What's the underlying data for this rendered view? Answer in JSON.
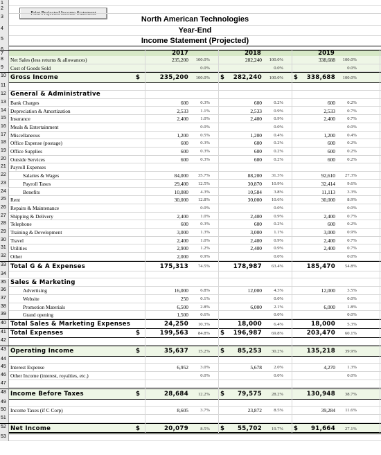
{
  "toolbar": {
    "print_label": "Print Projected Income Statement"
  },
  "header": {
    "company": "North American Technologies",
    "period": "Year-End",
    "statement": "Income Statement (Projected)"
  },
  "row_numbers": [
    "1",
    "2",
    "3",
    "4",
    "5",
    "6",
    "7",
    "8",
    "9",
    "10",
    "11",
    "12",
    "13",
    "14",
    "15",
    "16",
    "17",
    "18",
    "19",
    "20",
    "21",
    "22",
    "23",
    "24",
    "25",
    "26",
    "27",
    "28",
    "29",
    "30",
    "31",
    "32",
    "33",
    "34",
    "35",
    "36",
    "37",
    "38",
    "39",
    "40",
    "41",
    "42",
    "43",
    "44",
    "45",
    "46",
    "47",
    "48",
    "49",
    "50",
    "51",
    "52",
    "53"
  ],
  "years": [
    "2017",
    "2018",
    "2019"
  ],
  "currency": "$",
  "rows": {
    "net_sales": {
      "label": "Net Sales (less returns & allowances)",
      "v": [
        "235,200",
        "282,240",
        "338,688"
      ],
      "p": [
        "100.0%",
        "100.0%",
        "100.0%"
      ]
    },
    "cogs": {
      "label": "Cost of Goods Sold",
      "v": [
        "",
        "",
        ""
      ],
      "p": [
        "0.0%",
        "0.0%",
        "0.0%"
      ]
    },
    "gross_income": {
      "label": "Gross Income",
      "v": [
        "235,200",
        "282,240",
        "338,688"
      ],
      "p": [
        "100.0%",
        "100.0%",
        "100.0%"
      ]
    },
    "ga_header": "General & Administrative",
    "ga": [
      {
        "label": "Bank Charges",
        "v": [
          "600",
          "600",
          "600"
        ],
        "p": [
          "0.3%",
          "0.2%",
          "0.2%"
        ]
      },
      {
        "label": "Depreciation & Amortization",
        "v": [
          "2,533",
          "2,533",
          "2,533"
        ],
        "p": [
          "1.1%",
          "0.9%",
          "0.7%"
        ]
      },
      {
        "label": "Insurance",
        "v": [
          "2,400",
          "2,400",
          "2,400"
        ],
        "p": [
          "1.0%",
          "0.9%",
          "0.7%"
        ]
      },
      {
        "label": "Meals & Entertainment",
        "v": [
          "",
          "",
          ""
        ],
        "p": [
          "0.0%",
          "0.0%",
          "0.0%"
        ]
      },
      {
        "label": "Miscellaneous",
        "v": [
          "1,200",
          "1,200",
          "1,200"
        ],
        "p": [
          "0.5%",
          "0.4%",
          "0.4%"
        ]
      },
      {
        "label": "Office Expense (postage)",
        "v": [
          "600",
          "600",
          "600"
        ],
        "p": [
          "0.3%",
          "0.2%",
          "0.2%"
        ]
      },
      {
        "label": "Office Supplies",
        "v": [
          "600",
          "600",
          "600"
        ],
        "p": [
          "0.3%",
          "0.2%",
          "0.2%"
        ]
      },
      {
        "label": "Outside Services",
        "v": [
          "600",
          "600",
          "600"
        ],
        "p": [
          "0.3%",
          "0.2%",
          "0.2%"
        ]
      },
      {
        "label": "Payroll Expenses",
        "v": [
          "",
          "",
          ""
        ],
        "p": [
          "",
          "",
          ""
        ]
      },
      {
        "label": "Salaries & Wages",
        "indent": true,
        "v": [
          "84,000",
          "88,200",
          "92,610"
        ],
        "p": [
          "35.7%",
          "31.3%",
          "27.3%"
        ]
      },
      {
        "label": "Payroll Taxes",
        "indent": true,
        "v": [
          "29,400",
          "30,870",
          "32,414"
        ],
        "p": [
          "12.5%",
          "10.9%",
          "9.6%"
        ]
      },
      {
        "label": "Benefits",
        "indent": true,
        "v": [
          "10,080",
          "10,584",
          "11,113"
        ],
        "p": [
          "4.3%",
          "3.8%",
          "3.3%"
        ]
      },
      {
        "label": "Rent",
        "v": [
          "30,000",
          "30,000",
          "30,000"
        ],
        "p": [
          "12.8%",
          "10.6%",
          "8.9%"
        ]
      },
      {
        "label": "Repairs & Maintenance",
        "v": [
          "",
          "",
          ""
        ],
        "p": [
          "0.0%",
          "0.0%",
          "0.0%"
        ]
      },
      {
        "label": "Shipping & Delivery",
        "v": [
          "2,400",
          "2,400",
          "2,400"
        ],
        "p": [
          "1.0%",
          "0.9%",
          "0.7%"
        ]
      },
      {
        "label": "Telephone",
        "v": [
          "600",
          "600",
          "600"
        ],
        "p": [
          "0.3%",
          "0.2%",
          "0.2%"
        ]
      },
      {
        "label": "Training & Development",
        "v": [
          "3,000",
          "3,000",
          "3,000"
        ],
        "p": [
          "1.3%",
          "1.1%",
          "0.9%"
        ]
      },
      {
        "label": "Travel",
        "v": [
          "2,400",
          "2,400",
          "2,400"
        ],
        "p": [
          "1.0%",
          "0.9%",
          "0.7%"
        ]
      },
      {
        "label": "Utilities",
        "v": [
          "2,900",
          "2,400",
          "2,400"
        ],
        "p": [
          "1.2%",
          "0.9%",
          "0.7%"
        ]
      },
      {
        "label": "Other",
        "v": [
          "2,000",
          "",
          ""
        ],
        "p": [
          "0.9%",
          "0.0%",
          "0.0%"
        ]
      }
    ],
    "ga_total": {
      "label": "Total G & A Expenses",
      "v": [
        "175,313",
        "178,987",
        "185,470"
      ],
      "p": [
        "74.5%",
        "63.4%",
        "54.8%"
      ]
    },
    "sm_header": "Sales & Marketing",
    "sm": [
      {
        "label": "Advertising",
        "v": [
          "16,000",
          "12,000",
          "12,000"
        ],
        "p": [
          "6.8%",
          "4.3%",
          "3.5%"
        ]
      },
      {
        "label": "Website",
        "v": [
          "250",
          "",
          ""
        ],
        "p": [
          "0.1%",
          "0.0%",
          "0.0%"
        ]
      },
      {
        "label": "Promotion Materials",
        "v": [
          "6,500",
          "6,000",
          "6,000"
        ],
        "p": [
          "2.8%",
          "2.1%",
          "1.8%"
        ]
      },
      {
        "label": "Grand opening",
        "v": [
          "1,500",
          "",
          ""
        ],
        "p": [
          "0.6%",
          "0.0%",
          "0.0%"
        ]
      }
    ],
    "sm_total": {
      "label": "Total Sales & Marketing Expenses",
      "v": [
        "24,250",
        "18,000",
        "18,000"
      ],
      "p": [
        "10.3%",
        "6.4%",
        "5.3%"
      ]
    },
    "total_expenses": {
      "label": "Total Expenses",
      "v": [
        "199,563",
        "196,987",
        "203,470"
      ],
      "p": [
        "84.8%",
        "69.8%",
        "60.1%"
      ]
    },
    "operating_income": {
      "label": "Operating Income",
      "v": [
        "35,637",
        "85,253",
        "135,218"
      ],
      "p": [
        "15.2%",
        "30.2%",
        "39.9%"
      ]
    },
    "interest_expense": {
      "label": "Interest Expense",
      "v": [
        "6,952",
        "5,678",
        "4,270"
      ],
      "p": [
        "3.0%",
        "2.0%",
        "1.3%"
      ]
    },
    "other_income": {
      "label": "Other Income (interest, royalties, etc.)",
      "v": [
        "",
        "",
        ""
      ],
      "p": [
        "0.0%",
        "0.0%",
        "0.0%"
      ]
    },
    "income_before_taxes": {
      "label": "Income Before Taxes",
      "v": [
        "28,684",
        "79,575",
        "130,948"
      ],
      "p": [
        "12.2%",
        "28.2%",
        "38.7%"
      ]
    },
    "income_taxes": {
      "label": "Income Taxes (if C Corp)",
      "v": [
        "8,605",
        "23,872",
        "39,284"
      ],
      "p": [
        "3.7%",
        "8.5%",
        "11.6%"
      ]
    },
    "net_income": {
      "label": "Net Income",
      "v": [
        "20,079",
        "55,702",
        "91,664"
      ],
      "p": [
        "8.5%",
        "19.7%",
        "27.1%"
      ]
    }
  },
  "colors": {
    "header_fill": "#d6e8c6",
    "row_fill": "#eef6e6",
    "rownum_fill": "#e9e9e9"
  }
}
